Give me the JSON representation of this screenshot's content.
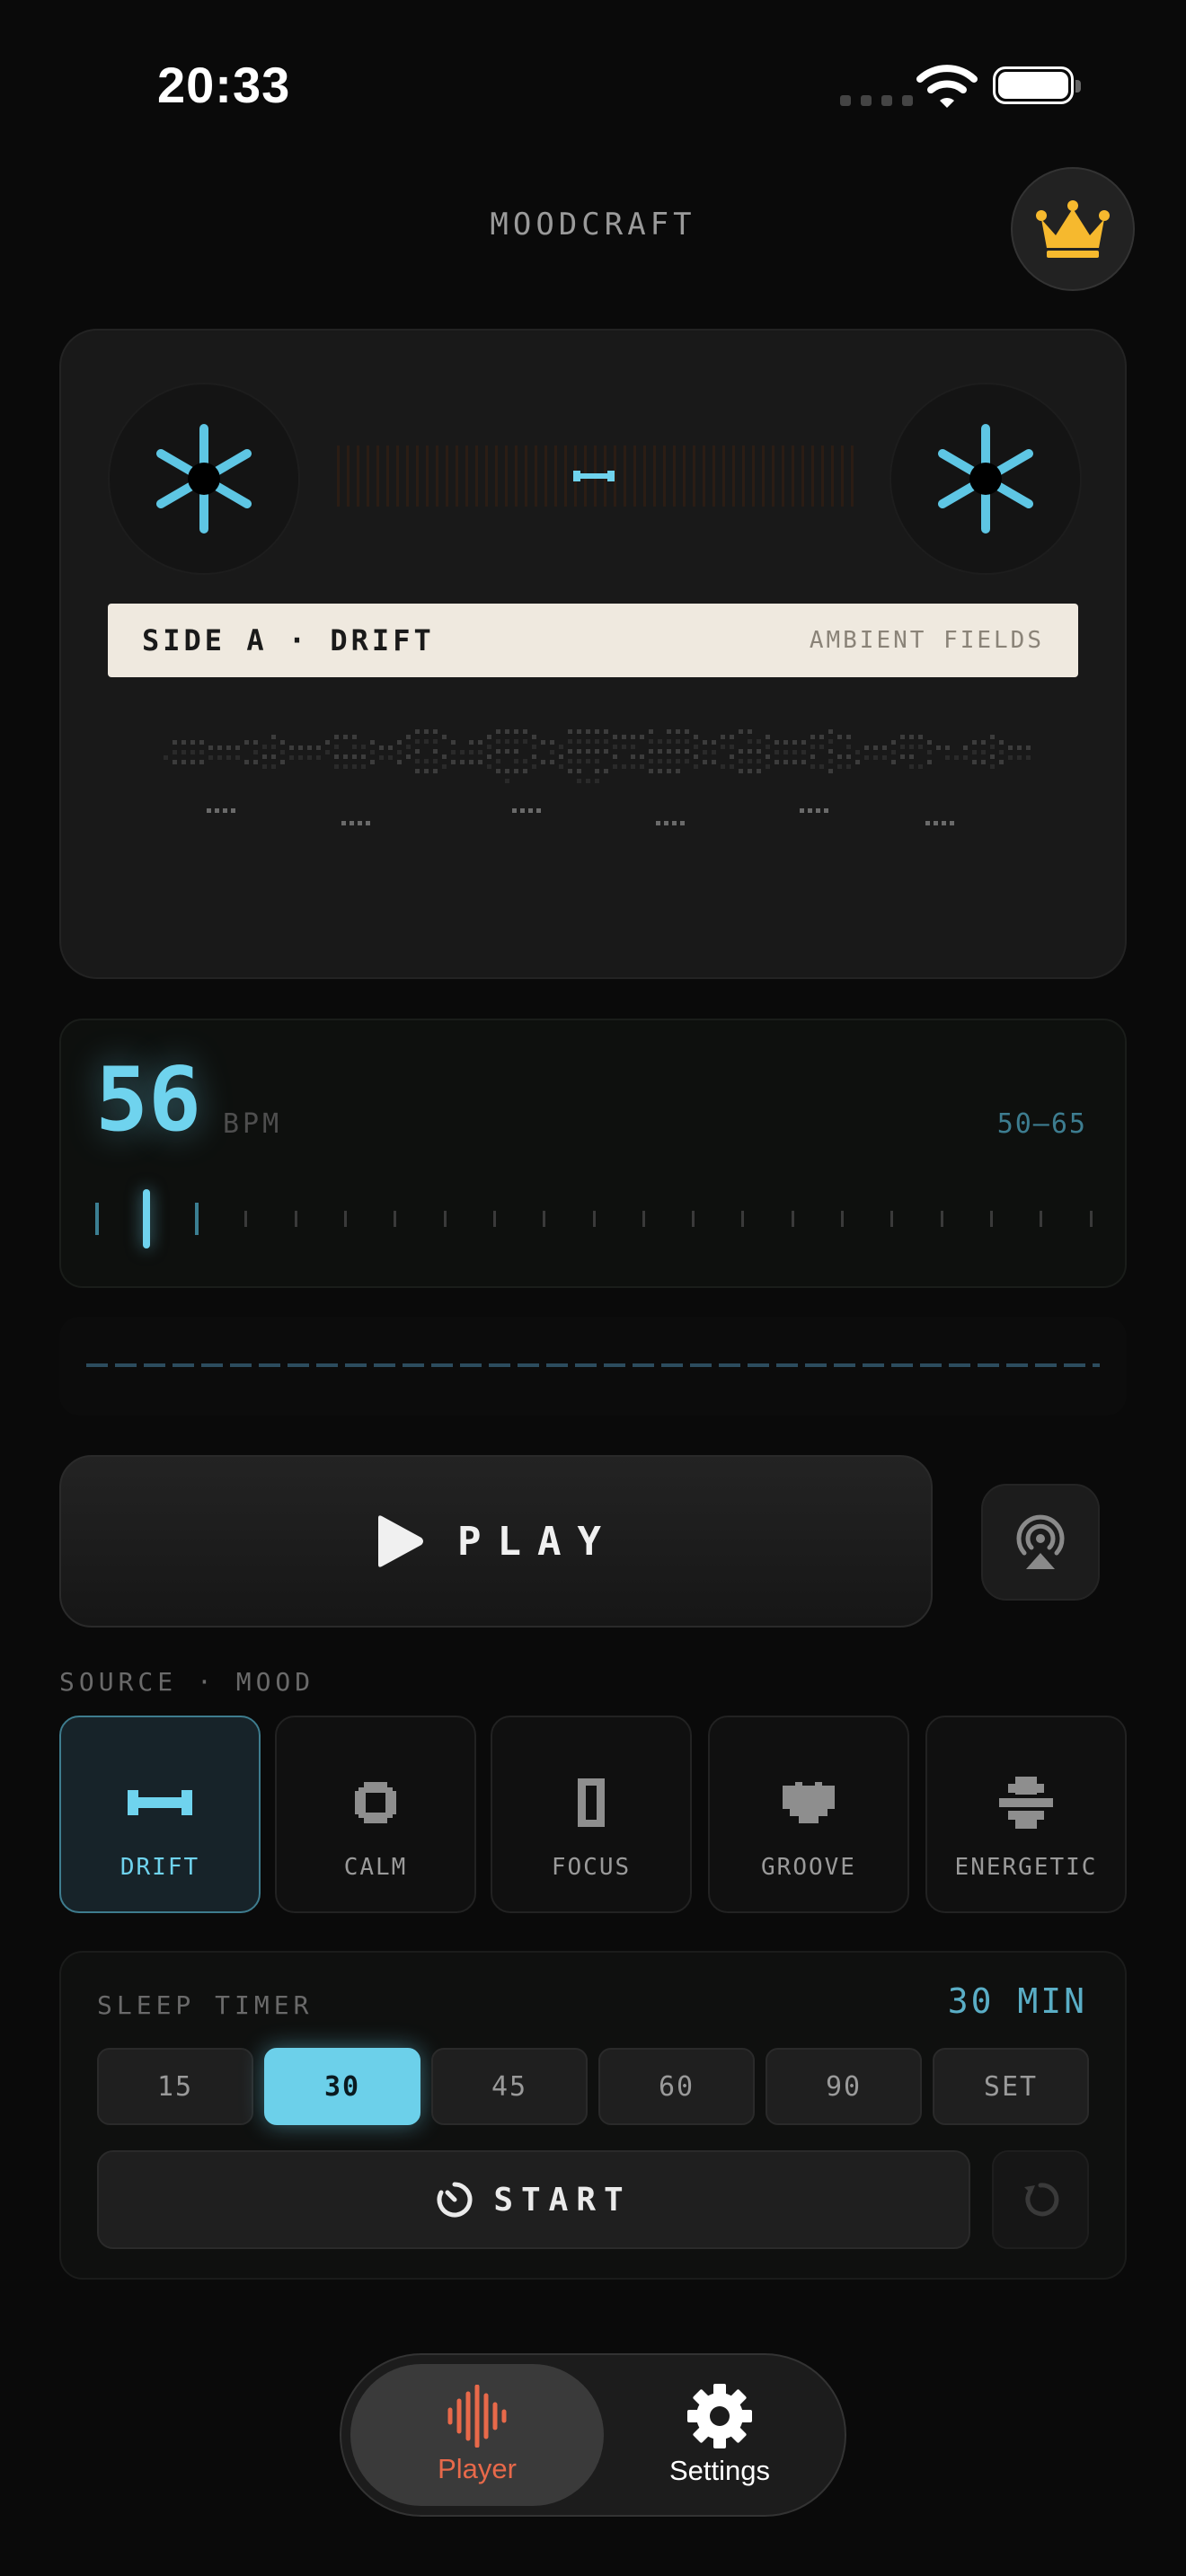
{
  "status": {
    "time": "20:33"
  },
  "app": {
    "title": "MOODCRAFT",
    "premium_icon": "crown-icon"
  },
  "cassette": {
    "label_main": "SIDE A · DRIFT",
    "label_sub": "AMBIENT FIELDS"
  },
  "bpm": {
    "value": "56",
    "unit": "BPM",
    "range": "50—65"
  },
  "player": {
    "play_label": "PLAY",
    "airplay_icon": "airplay-icon"
  },
  "mood": {
    "section_label": "SOURCE · MOOD",
    "selected": "DRIFT",
    "items": [
      {
        "label": "DRIFT",
        "icon": "drift-icon"
      },
      {
        "label": "CALM",
        "icon": "calm-icon"
      },
      {
        "label": "FOCUS",
        "icon": "focus-icon"
      },
      {
        "label": "GROOVE",
        "icon": "groove-icon"
      },
      {
        "label": "ENERGETIC",
        "icon": "energetic-icon"
      }
    ]
  },
  "timer": {
    "label": "SLEEP TIMER",
    "value": "30 MIN",
    "options": [
      "15",
      "30",
      "45",
      "60",
      "90",
      "SET"
    ],
    "selected": "30",
    "start_label": "START"
  },
  "tabs": {
    "player": "Player",
    "settings": "Settings"
  },
  "colors": {
    "accent": "#6fd3ee",
    "active_tab": "#e8694a",
    "crown": "#f6b92e",
    "background": "#0a0a0a"
  }
}
